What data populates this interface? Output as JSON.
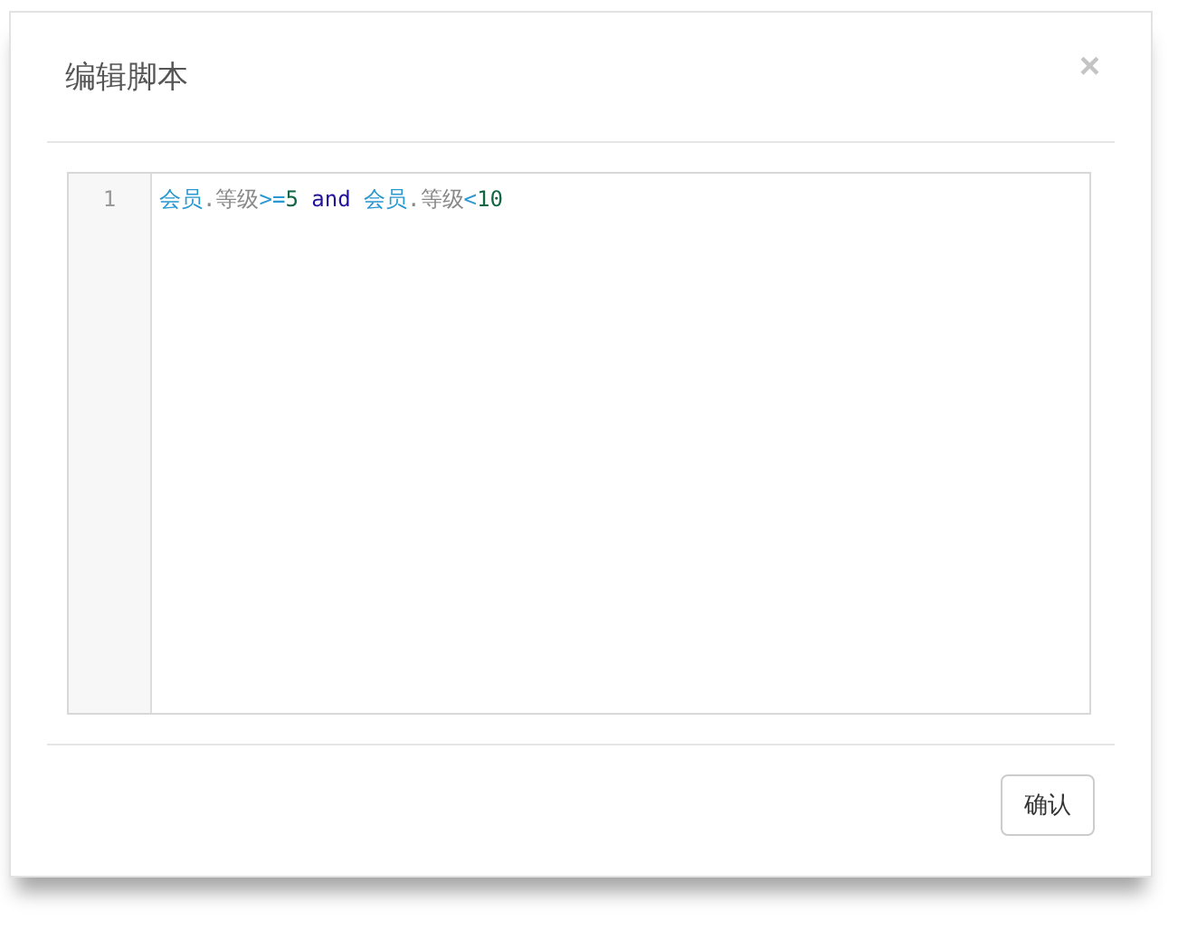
{
  "dialog": {
    "title": "编辑脚本",
    "close": "×"
  },
  "editor": {
    "lines": [
      {
        "number": "1",
        "tokens": [
          {
            "kind": "variable",
            "text": "会员"
          },
          {
            "kind": "punct",
            "text": "."
          },
          {
            "kind": "property",
            "text": "等级"
          },
          {
            "kind": "operator",
            "text": ">="
          },
          {
            "kind": "number",
            "text": "5"
          },
          {
            "kind": "keyword",
            "text": "and"
          },
          {
            "kind": "variable",
            "text": "会员"
          },
          {
            "kind": "punct",
            "text": "."
          },
          {
            "kind": "property",
            "text": "等级"
          },
          {
            "kind": "operator",
            "text": "<"
          },
          {
            "kind": "number",
            "text": "10"
          }
        ]
      }
    ]
  },
  "footer": {
    "buttons": [
      {
        "label": "确认"
      }
    ]
  }
}
